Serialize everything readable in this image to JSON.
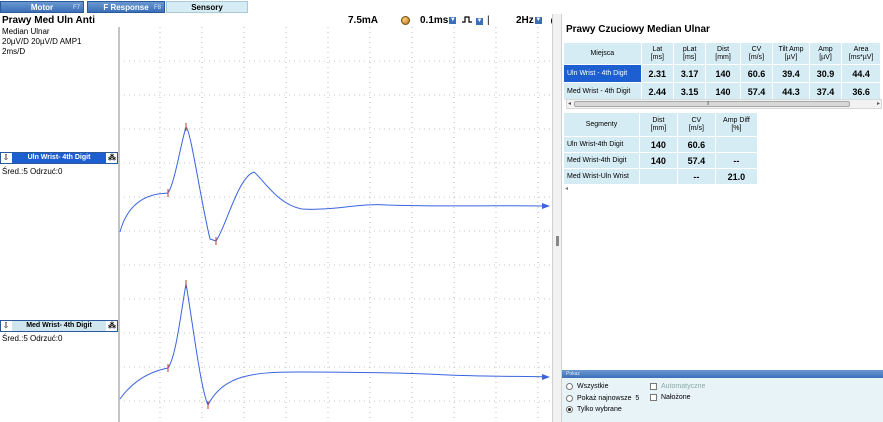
{
  "tabs": [
    {
      "label": "Motor",
      "key": "F7"
    },
    {
      "label": "F Response",
      "key": "F8"
    },
    {
      "label": "Sensory",
      "key": ""
    }
  ],
  "toolbar": {
    "title": "Prawy Med Uln Anti",
    "stimulus": "7.5mA",
    "sweep": "0.1ms",
    "rate": "2Hz"
  },
  "info": {
    "line1": "Median Ulnar",
    "line2": "20µV/D  20µV/D  AMP1",
    "line3": "2ms/D"
  },
  "traces": [
    {
      "label": "Uln Wrist- 4th Digit",
      "stats": "Śred.:5  Odrzuć:0"
    },
    {
      "label": "Med Wrist- 4th Digit",
      "stats": "Śred.:5  Odrzuć:0"
    }
  ],
  "results": {
    "title": "Prawy Czuciowy Median Ulnar",
    "headers": [
      "Miejsca",
      "Lat\n[ms]",
      "pLat\n[ms]",
      "Dist\n[mm]",
      "CV\n[m/s]",
      "Tilt Amp\n[µV]",
      "Amp\n[µV]",
      "Area\n[ms*µV]"
    ],
    "rows": [
      [
        "Uln Wrist - 4th Digit",
        "2.31",
        "3.17",
        "140",
        "60.6",
        "39.4",
        "30.9",
        "44.4"
      ],
      [
        "Med Wrist - 4th Digit",
        "2.44",
        "3.15",
        "140",
        "57.4",
        "44.3",
        "37.4",
        "36.6"
      ]
    ]
  },
  "segments": {
    "headers": [
      "Segmenty",
      "Dist\n[mm]",
      "CV\n[m/s]",
      "Amp Diff\n[%]"
    ],
    "rows": [
      [
        "Uln Wrist-4th Digit",
        "140",
        "60.6",
        ""
      ],
      [
        "Med Wrist-4th Digit",
        "140",
        "57.4",
        "--"
      ],
      [
        "Med Wrist-Uln Wrist",
        "",
        "--",
        "21.0"
      ]
    ]
  },
  "options": {
    "header": "Pokaz",
    "all": "Wszystkie",
    "latest": "Pokaż najnowsze",
    "latest_count": "5",
    "selected": "Tylko wybrane",
    "auto": "Automatyczne",
    "overlay": "Nałożone"
  },
  "colors": {
    "accent": "#1d5fd1",
    "trace": "#3a64e0",
    "marker": "#c0392b",
    "cell": "#d6ecf4"
  }
}
